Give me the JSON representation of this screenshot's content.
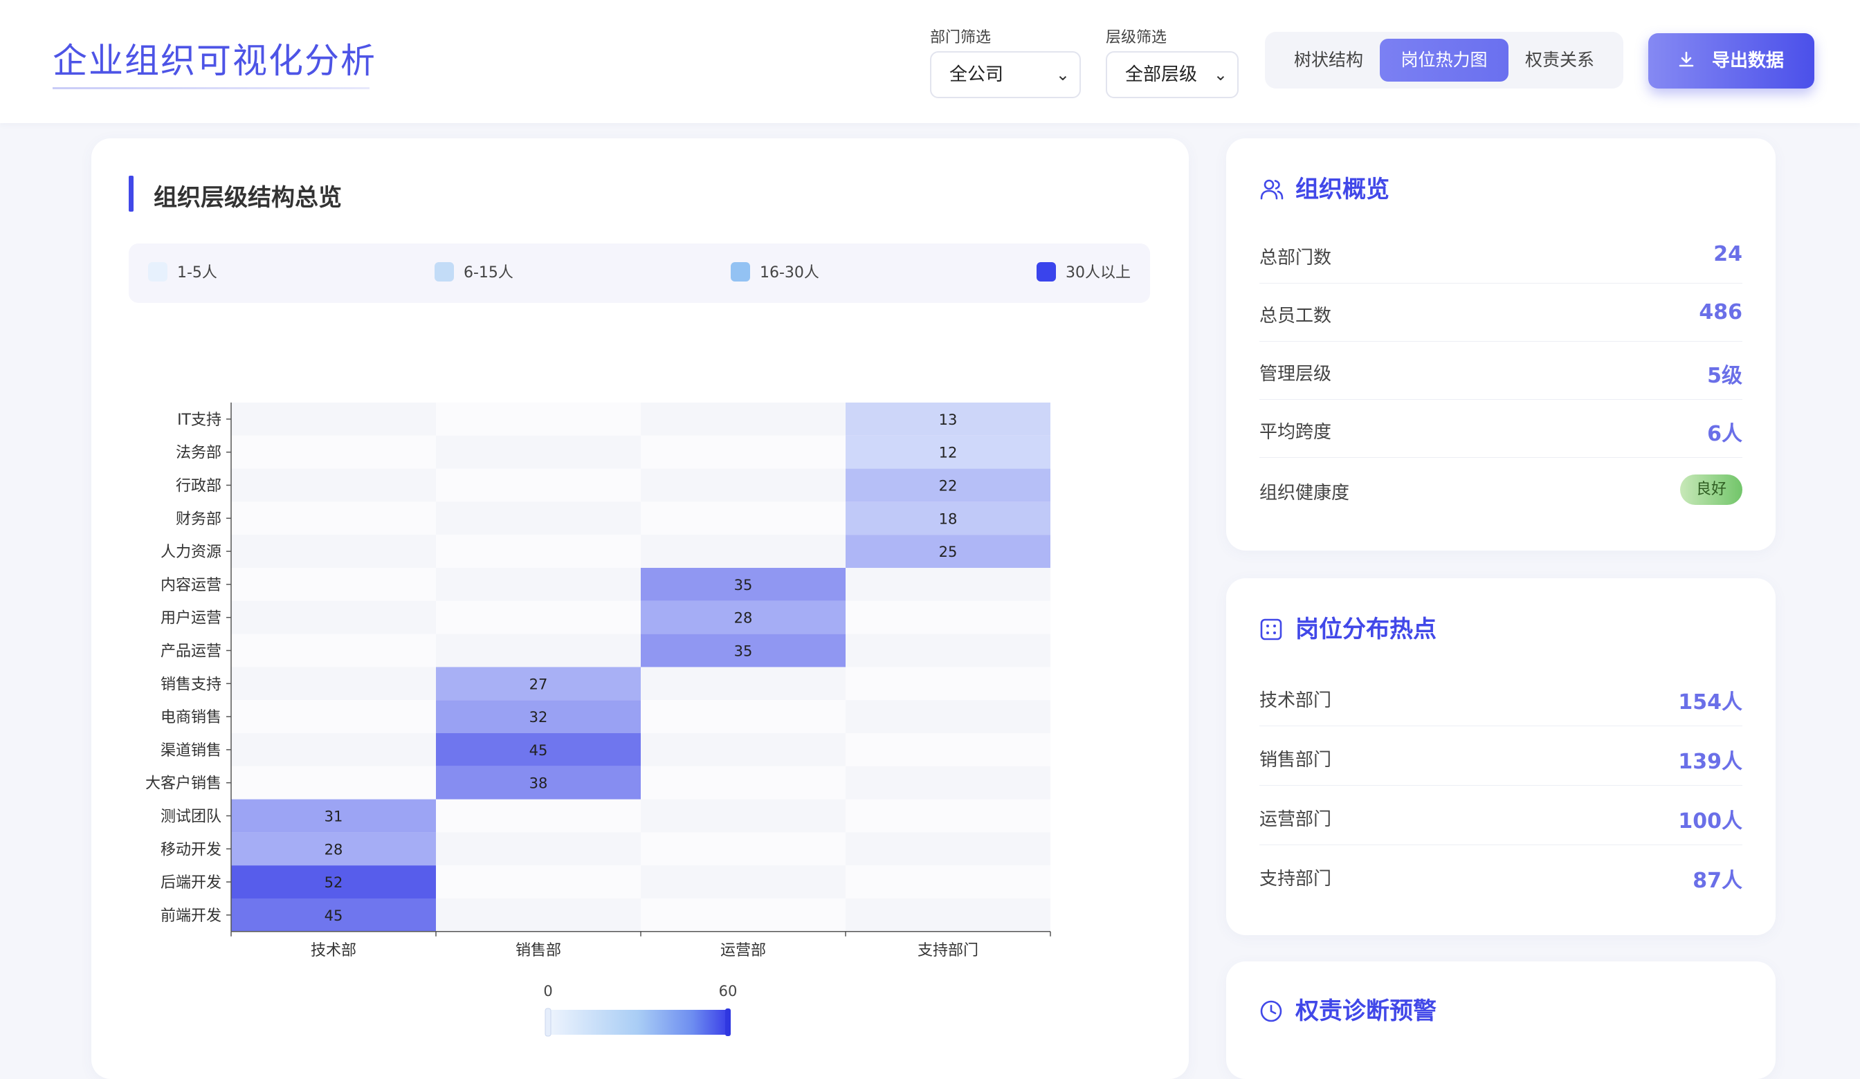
{
  "header": {
    "title": "企业组织可视化分析",
    "dept_filter_label": "部门筛选",
    "dept_filter_value": "全公司",
    "level_filter_label": "层级筛选",
    "level_filter_value": "全部层级",
    "tabs": [
      {
        "label": "树状结构",
        "active": false
      },
      {
        "label": "岗位热力图",
        "active": true
      },
      {
        "label": "权责关系",
        "active": false
      }
    ],
    "export_label": "导出数据"
  },
  "main": {
    "title": "组织层级结构总览",
    "legend": [
      {
        "label": "1-5人",
        "color": "#e7f1fd"
      },
      {
        "label": "6-15人",
        "color": "#c3dcf7"
      },
      {
        "label": "16-30人",
        "color": "#93c2f3"
      },
      {
        "label": "30人以上",
        "color": "#3a44ec"
      }
    ]
  },
  "chart_data": {
    "type": "heatmap",
    "x_categories": [
      "技术部",
      "销售部",
      "运营部",
      "支持部门"
    ],
    "y_categories": [
      "IT支持",
      "法务部",
      "行政部",
      "财务部",
      "人力资源",
      "内容运营",
      "用户运营",
      "产品运营",
      "销售支持",
      "电商销售",
      "渠道销售",
      "大客户销售",
      "测试团队",
      "移动开发",
      "后端开发",
      "前端开发"
    ],
    "cells": [
      {
        "y": "IT支持",
        "x": "支持部门",
        "value": 13
      },
      {
        "y": "法务部",
        "x": "支持部门",
        "value": 12
      },
      {
        "y": "行政部",
        "x": "支持部门",
        "value": 22
      },
      {
        "y": "财务部",
        "x": "支持部门",
        "value": 18
      },
      {
        "y": "人力资源",
        "x": "支持部门",
        "value": 25
      },
      {
        "y": "内容运营",
        "x": "运营部",
        "value": 35
      },
      {
        "y": "用户运营",
        "x": "运营部",
        "value": 28
      },
      {
        "y": "产品运营",
        "x": "运营部",
        "value": 35
      },
      {
        "y": "销售支持",
        "x": "销售部",
        "value": 27
      },
      {
        "y": "电商销售",
        "x": "销售部",
        "value": 32
      },
      {
        "y": "渠道销售",
        "x": "销售部",
        "value": 45
      },
      {
        "y": "大客户销售",
        "x": "销售部",
        "value": 38
      },
      {
        "y": "测试团队",
        "x": "技术部",
        "value": 31
      },
      {
        "y": "移动开发",
        "x": "技术部",
        "value": 28
      },
      {
        "y": "后端开发",
        "x": "技术部",
        "value": 52
      },
      {
        "y": "前端开发",
        "x": "技术部",
        "value": 45
      }
    ],
    "color_scale": {
      "min": 0,
      "max": 60,
      "low_color": "#e4eefc",
      "high_color": "#3a3fe8"
    }
  },
  "overview": {
    "title": "组织概览",
    "icon": "users-icon",
    "rows": [
      {
        "label": "总部门数",
        "value": "24"
      },
      {
        "label": "总员工数",
        "value": "486"
      },
      {
        "label": "管理层级",
        "value": "5级"
      },
      {
        "label": "平均跨度",
        "value": "6人"
      },
      {
        "label": "组织健康度",
        "badge": "良好"
      }
    ]
  },
  "hotspots": {
    "title": "岗位分布热点",
    "icon": "grid-icon",
    "rows": [
      {
        "label": "技术部门",
        "value": "154人"
      },
      {
        "label": "销售部门",
        "value": "139人"
      },
      {
        "label": "运营部门",
        "value": "100人"
      },
      {
        "label": "支持部门",
        "value": "87人"
      }
    ]
  },
  "diagnosis": {
    "title": "权责诊断预警",
    "icon": "clock-icon"
  }
}
